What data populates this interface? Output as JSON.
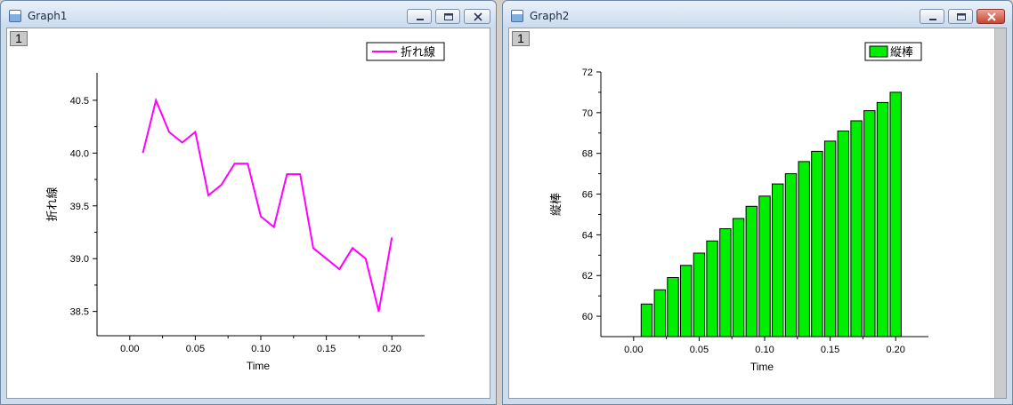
{
  "windows": [
    {
      "title": "Graph1",
      "layer_label": "1",
      "icons": [
        "graph-window-icon",
        "minimize-icon",
        "maximize-icon",
        "close-icon"
      ],
      "close_style": "inactive"
    },
    {
      "title": "Graph2",
      "layer_label": "1",
      "icons": [
        "graph-window-icon",
        "minimize-icon",
        "maximize-icon",
        "close-icon"
      ],
      "close_style": "active-red"
    }
  ],
  "chart_data": [
    {
      "type": "line",
      "xlabel": "Time",
      "ylabel": "折れ線",
      "xlim": [
        -0.025,
        0.225
      ],
      "ylim": [
        38.27,
        40.76
      ],
      "xticks": [
        "0.00",
        "0.05",
        "0.10",
        "0.15",
        "0.20"
      ],
      "yticks": [
        "38.5",
        "39.0",
        "39.5",
        "40.0",
        "40.5"
      ],
      "legend": "top-right",
      "series": [
        {
          "name": "折れ線",
          "color": "#ff00ff",
          "x": [
            0.01,
            0.02,
            0.03,
            0.04,
            0.05,
            0.06,
            0.07,
            0.08,
            0.09,
            0.1,
            0.11,
            0.12,
            0.13,
            0.14,
            0.15,
            0.16,
            0.17,
            0.18,
            0.19,
            0.2
          ],
          "y": [
            40.0,
            40.5,
            40.2,
            40.1,
            40.2,
            39.6,
            39.7,
            39.9,
            39.9,
            39.4,
            39.3,
            39.8,
            39.8,
            39.1,
            39.0,
            38.9,
            39.1,
            39.0,
            38.5,
            39.2
          ]
        }
      ]
    },
    {
      "type": "bar",
      "xlabel": "Time",
      "ylabel": "縦棒",
      "xlim": [
        -0.025,
        0.225
      ],
      "ylim": [
        59.0,
        72.0
      ],
      "xticks": [
        "0.00",
        "0.05",
        "0.10",
        "0.15",
        "0.20"
      ],
      "yticks": [
        "60",
        "62",
        "64",
        "66",
        "68",
        "70",
        "72"
      ],
      "legend": "top-right",
      "series": [
        {
          "name": "縦棒",
          "color": "#00ee00",
          "x": [
            0.01,
            0.02,
            0.03,
            0.04,
            0.05,
            0.06,
            0.07,
            0.08,
            0.09,
            0.1,
            0.11,
            0.12,
            0.13,
            0.14,
            0.15,
            0.16,
            0.17,
            0.18,
            0.19,
            0.2
          ],
          "y": [
            60.6,
            61.3,
            61.9,
            62.5,
            63.1,
            63.7,
            64.3,
            64.8,
            65.4,
            65.9,
            66.5,
            67.0,
            67.6,
            68.1,
            68.6,
            69.1,
            69.6,
            70.1,
            70.5,
            71.0
          ]
        }
      ]
    }
  ]
}
